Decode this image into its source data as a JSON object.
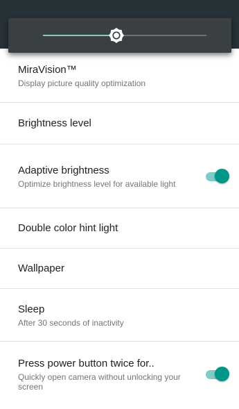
{
  "brightness_slider": {
    "level": 0.45,
    "icon": "brightness-icon",
    "colors": {
      "fill": "#80cbc4",
      "track": "#6b7174",
      "panel": "#3a3f42",
      "thumb": "#ffffff"
    }
  },
  "settings": [
    {
      "title": "MiraVision™",
      "summary": "Display picture quality optimization"
    },
    {
      "title": "Brightness level"
    },
    {
      "title": "Adaptive brightness",
      "summary": "Optimize brightness level for available light",
      "toggle": true
    },
    {
      "title": "Double color hint light"
    },
    {
      "title": "Wallpaper"
    },
    {
      "title": "Sleep",
      "summary": "After 30 seconds of inactivity"
    },
    {
      "title": "Press power button twice for..",
      "summary": "Quickly open camera without unlocking your screen",
      "toggle": true
    }
  ],
  "colors": {
    "accent": "#009688",
    "accent_light": "#80cbc4",
    "status_bar": "#263238"
  }
}
